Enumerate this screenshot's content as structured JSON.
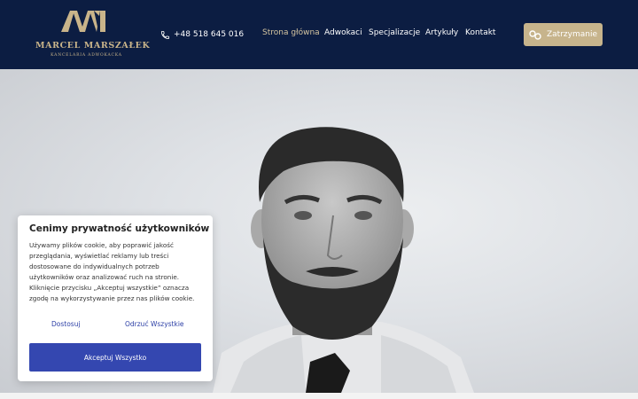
{
  "brand": {
    "name": "MARCEL MARSZAŁEK",
    "subtitle": "KANCELARIA ADWOKACKA",
    "color": "#c9b48a"
  },
  "header": {
    "phone": "+48 518 645 016",
    "nav": [
      {
        "label": "Strona główna",
        "active": true
      },
      {
        "label": "Adwokaci",
        "active": false
      },
      {
        "label": "Specjalizacje",
        "active": false
      },
      {
        "label": "Artykuły",
        "active": false
      },
      {
        "label": "Kontakt",
        "active": false
      }
    ],
    "cta_label": "Zatrzymanie",
    "background": "#0c1d42",
    "cta_color": "#c7b48c"
  },
  "cookie": {
    "title": "Cenimy prywatność użytkowników",
    "body_lines": [
      "Używamy plików cookie, aby poprawić jakość",
      "przeglądania, wyświetlać reklamy lub treści",
      "dostosowane do indywidualnych potrzeb",
      "użytkowników oraz analizować ruch na stronie.",
      "Kliknięcie przycisku „Akceptuj wszystkie” oznacza",
      "zgodę na wykorzystywanie przez nas plików cookie."
    ],
    "customize_label": "Dostosuj",
    "reject_label": "Odrzuć Wszystkie",
    "accept_label": "Akceptuj Wszystko",
    "accent_color": "#3447b0"
  }
}
